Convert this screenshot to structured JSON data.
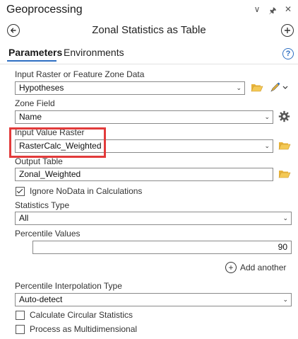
{
  "pane": {
    "title": "Geoprocessing",
    "controls": [
      "∨",
      "⨯",
      "×"
    ]
  },
  "tool": {
    "title": "Zonal Statistics as Table",
    "back_icon": "back-arrow-icon",
    "add_icon": "plus-icon"
  },
  "tabs": {
    "parameters": "Parameters",
    "environments": "Environments",
    "help": "?"
  },
  "params": {
    "zone_data_label": "Input Raster or Feature Zone Data",
    "zone_data_value": "Hypotheses",
    "zone_field_label": "Zone Field",
    "zone_field_value": "Name",
    "value_raster_label": "Input Value Raster",
    "value_raster_value": "RasterCalc_Weighted",
    "output_table_label": "Output Table",
    "output_table_value": "Zonal_Weighted",
    "ignore_nodata_label": "Ignore NoData in Calculations",
    "ignore_nodata_checked": true,
    "stats_type_label": "Statistics Type",
    "stats_type_value": "All",
    "percentile_label": "Percentile Values",
    "percentile_value": "90",
    "add_another_label": "Add another",
    "interp_label": "Percentile Interpolation Type",
    "interp_value": "Auto-detect",
    "circular_label": "Calculate Circular Statistics",
    "circular_checked": false,
    "multidim_label": "Process as Multidimensional",
    "multidim_checked": false
  },
  "colors": {
    "accent": "#2e6fc2",
    "highlight": "#e23b3b",
    "folder": "#e8b33a"
  }
}
